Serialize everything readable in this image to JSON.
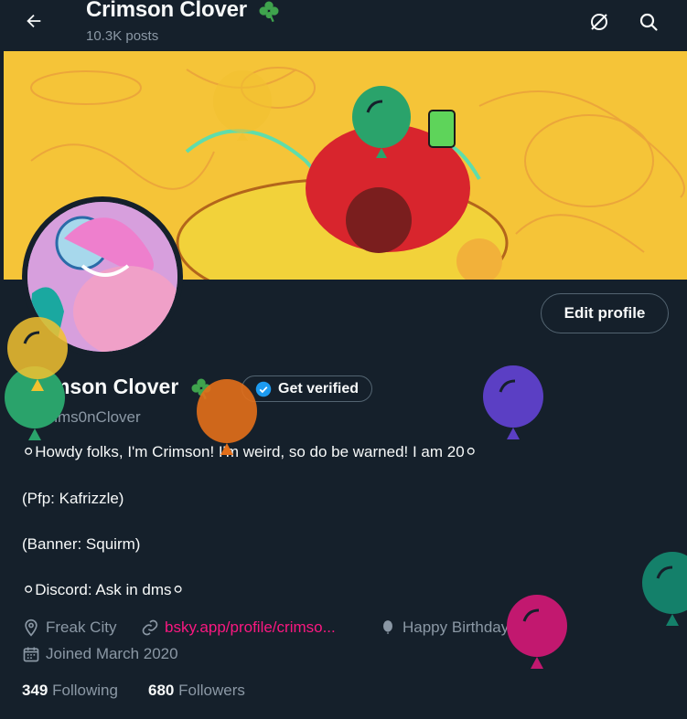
{
  "header": {
    "title": "Crimson Clover",
    "posts": "10.3K posts"
  },
  "profile": {
    "edit_label": "Edit profile",
    "name": "Crimson Clover",
    "verify_label": "Get verified",
    "handle": "@Crims0nClover",
    "bio": [
      "⚪Howdy folks, I'm Crimson! I'm weird, so do be warned! I am 20⚪",
      "(Pfp: Kafrizzle)",
      "(Banner: Squirm)",
      "⚪Discord: Ask in dms⚪"
    ],
    "location": "Freak City",
    "website": "bsky.app/profile/crimso...",
    "birthday": "Happy Birthday!",
    "joined": "Joined March 2020",
    "following_count": "349",
    "following_label": "Following",
    "followers_count": "680",
    "followers_label": "Followers"
  },
  "colors": {
    "background": "#15202b",
    "text": "#f7f9f9",
    "muted": "#8b98a5",
    "link": "#f91880",
    "verified_badge": "#1d9bf0",
    "clover": "#3fa34d"
  },
  "balloons": [
    "#f2c230",
    "#2aa36b",
    "#e36f1a",
    "#5b3fc4",
    "#c2186f",
    "#14806a"
  ]
}
